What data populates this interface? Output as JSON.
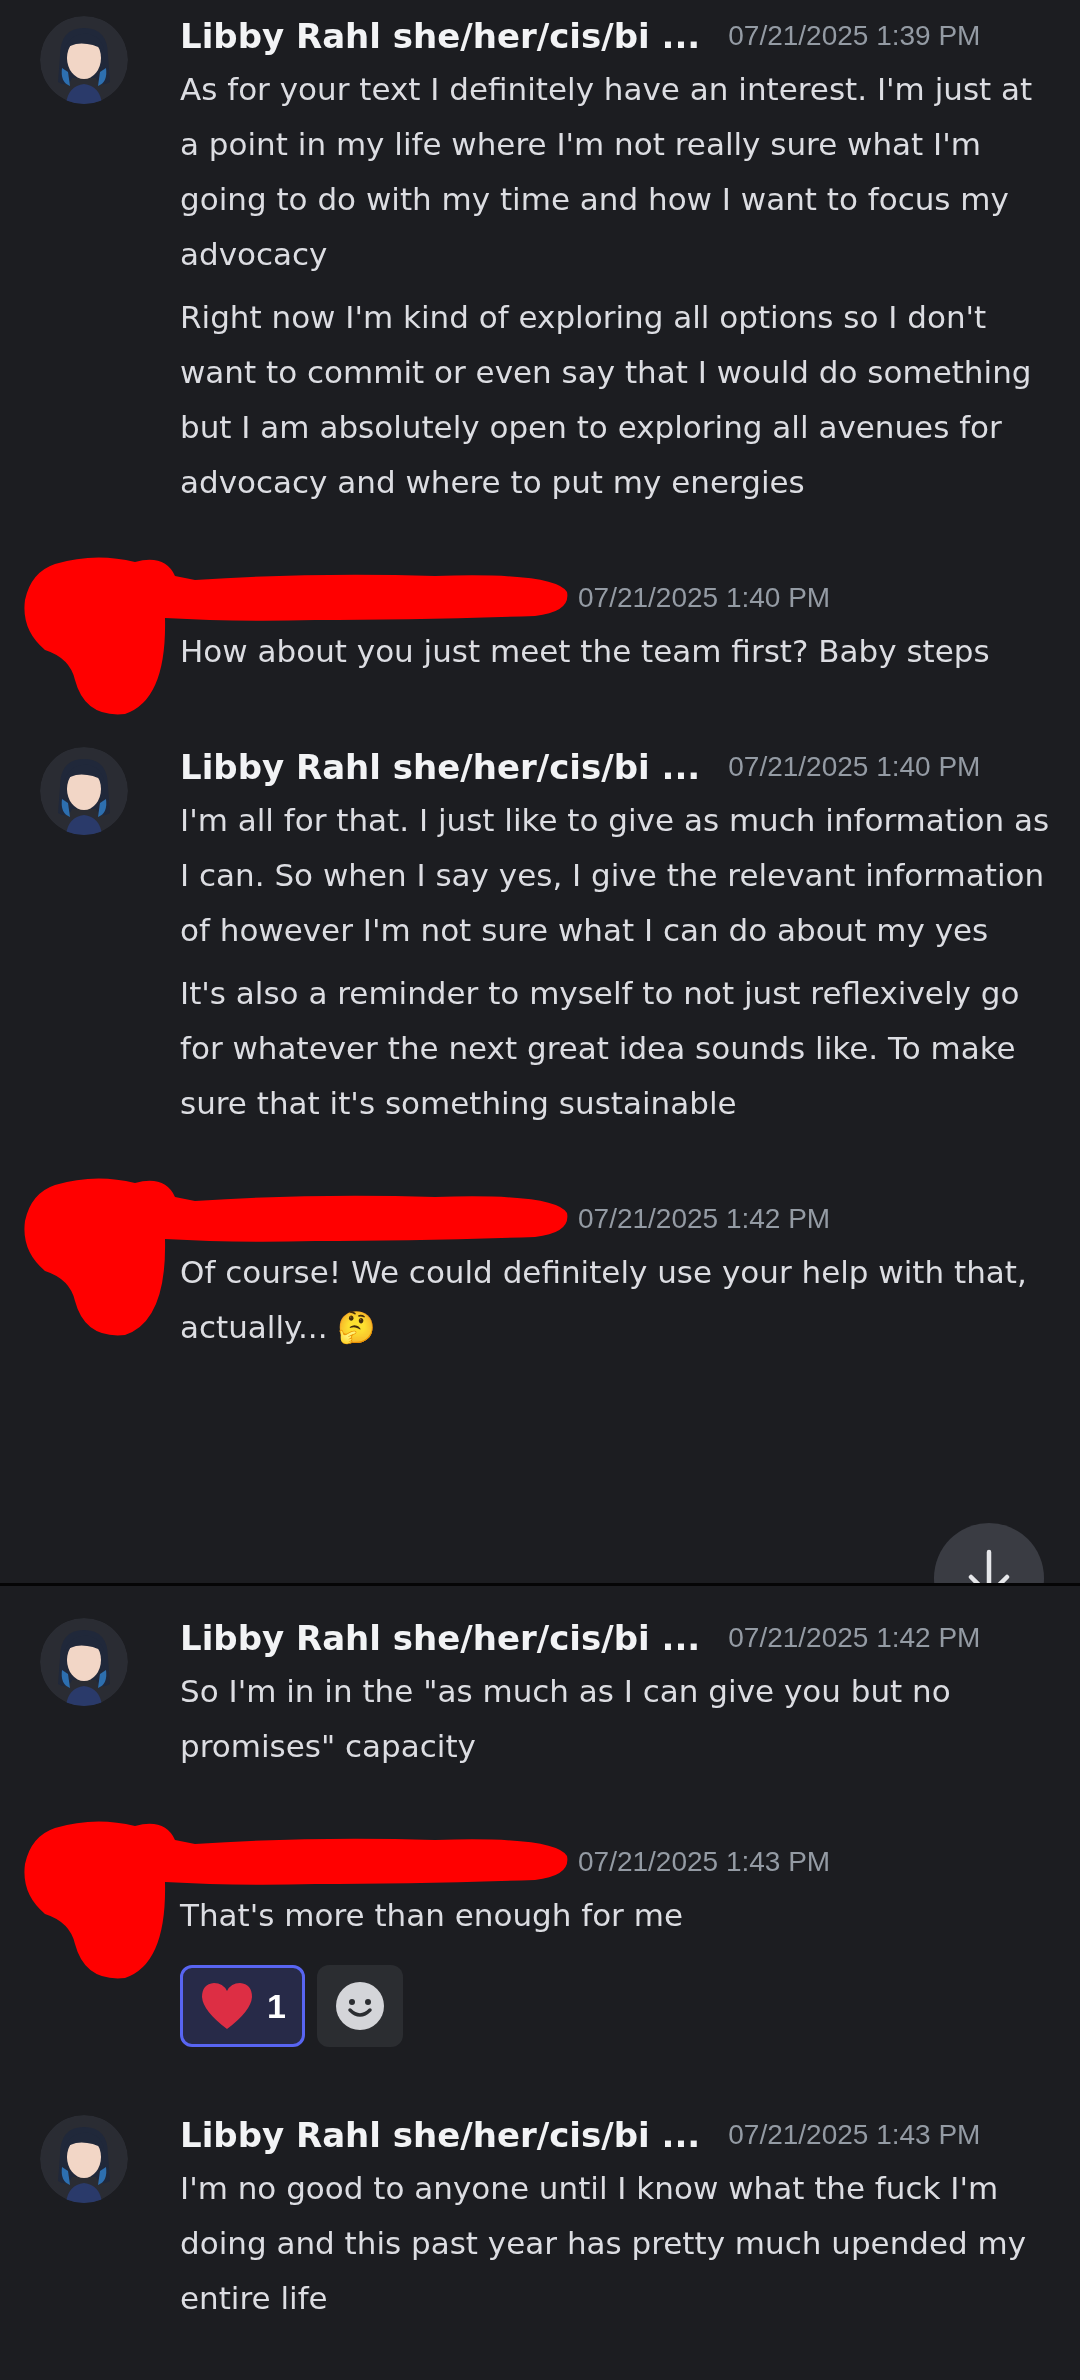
{
  "sections": [
    {
      "messages": [
        {
          "author": "Libby Rahl she/her/cis/bi ...",
          "redacted": false,
          "timestamp": "07/21/2025 1:39 PM",
          "paragraphs": [
            "As for your text I definitely have an interest. I'm just at a point in my life where I'm not really sure what I'm going to do with my time and how I want to focus my advocacy",
            "Right now I'm kind of exploring all options so I don't want to commit or even say that I would do something but I am absolutely open to exploring all avenues for advocacy and where to put my energies"
          ]
        },
        {
          "redacted": true,
          "timestamp": "07/21/2025 1:40 PM",
          "paragraphs": [
            "How about you just meet the team first? Baby steps"
          ]
        },
        {
          "author": "Libby Rahl she/her/cis/bi ...",
          "redacted": false,
          "timestamp": "07/21/2025 1:40 PM",
          "paragraphs": [
            "I'm all for that. I just like to give as much information as I can. So when I say yes, I give the relevant information of however I'm not sure what I can do about my yes",
            "It's also a reminder to myself to not just reflexively go for whatever the next great idea sounds like. To make sure that it's something sustainable"
          ]
        },
        {
          "redacted": true,
          "timestamp": "07/21/2025 1:42 PM",
          "paragraphs": [
            "Of course! We could definitely use your help with that, actually... 🤔"
          ]
        }
      ],
      "scroll_button": true
    },
    {
      "messages": [
        {
          "author": "Libby Rahl she/her/cis/bi ...",
          "redacted": false,
          "timestamp": "07/21/2025 1:42 PM",
          "paragraphs": [
            "So I'm in in the \"as much as I can give you but no promises\" capacity"
          ]
        },
        {
          "redacted": true,
          "timestamp": "07/21/2025 1:43 PM",
          "paragraphs": [
            "That's more than enough for me"
          ],
          "reactions": [
            {
              "count": "1",
              "selected": true
            }
          ]
        },
        {
          "author": "Libby Rahl she/her/cis/bi ...",
          "redacted": false,
          "timestamp": "07/21/2025 1:43 PM",
          "paragraphs": [
            "I'm no good to anyone until I know what the fuck I'm doing and this past year has pretty much upended my entire life"
          ]
        }
      ],
      "scroll_button": false
    }
  ]
}
